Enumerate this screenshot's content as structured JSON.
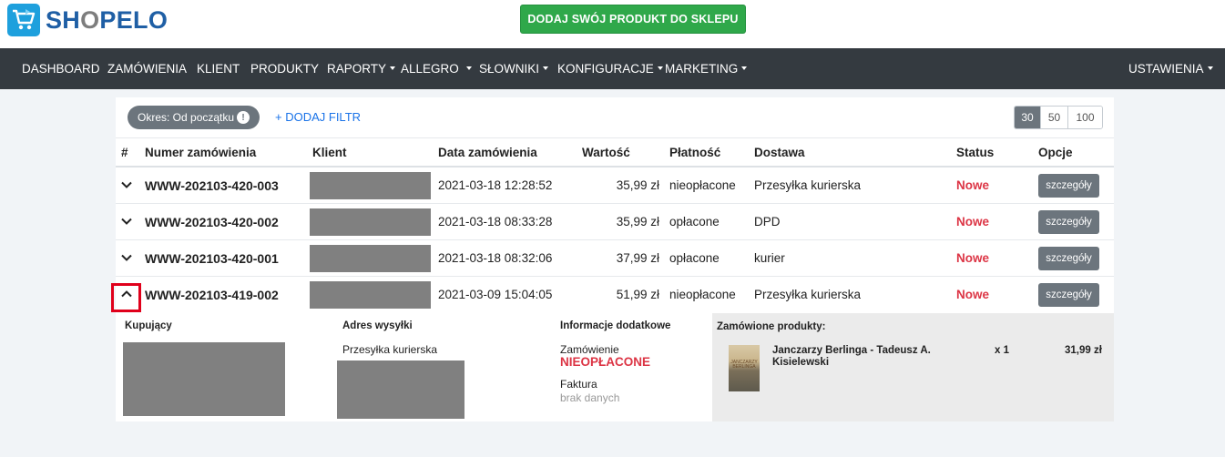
{
  "header": {
    "logo_text": "SHOPELO",
    "cta_label": "DODAJ SWÓJ PRODUKT DO SKLEPU"
  },
  "nav": {
    "items": [
      {
        "label": "DASHBOARD",
        "dropdown": false
      },
      {
        "label": "ZAMÓWIENIA",
        "dropdown": false
      },
      {
        "label": "KLIENT",
        "dropdown": false
      },
      {
        "label": "PRODUKTY",
        "dropdown": false
      },
      {
        "label": "RAPORTY",
        "dropdown": true
      },
      {
        "label": "ALLEGRO",
        "dropdown": true
      },
      {
        "label": "SŁOWNIKI",
        "dropdown": true
      },
      {
        "label": "KONFIGURACJE",
        "dropdown": true
      },
      {
        "label": "MARKETING",
        "dropdown": true
      }
    ],
    "settings_label": "USTAWIENIA"
  },
  "filters": {
    "period_label": "Okres: Od początku",
    "add_filter_label": "+ DODAJ FILTR",
    "page_sizes": [
      "30",
      "50",
      "100"
    ],
    "selected_page_size": "30"
  },
  "table": {
    "headers": {
      "hash": "#",
      "order_number": "Numer zamówienia",
      "client": "Klient",
      "date": "Data zamówienia",
      "value": "Wartość",
      "payment": "Płatność",
      "delivery": "Dostawa",
      "status": "Status",
      "options": "Opcje"
    },
    "rows": [
      {
        "order_number": "WWW-202103-420-003",
        "date": "2021-03-18 12:28:52",
        "value": "35,99 zł",
        "payment": "nieopłacone",
        "delivery": "Przesyłka kurierska",
        "status": "Nowe",
        "action": "szczegóły",
        "expanded": false
      },
      {
        "order_number": "WWW-202103-420-002",
        "date": "2021-03-18 08:33:28",
        "value": "35,99 zł",
        "payment": "opłacone",
        "delivery": "DPD",
        "status": "Nowe",
        "action": "szczegóły",
        "expanded": false
      },
      {
        "order_number": "WWW-202103-420-001",
        "date": "2021-03-18 08:32:06",
        "value": "37,99 zł",
        "payment": "opłacone",
        "delivery": "kurier",
        "status": "Nowe",
        "action": "szczegóły",
        "expanded": false
      },
      {
        "order_number": "WWW-202103-419-002",
        "date": "2021-03-09 15:04:05",
        "value": "51,99 zł",
        "payment": "nieopłacone",
        "delivery": "Przesyłka kurierska",
        "status": "Nowe",
        "action": "szczegóły",
        "expanded": true
      }
    ]
  },
  "detail": {
    "buyer_title": "Kupujący",
    "shipping_title": "Adres wysyłki",
    "shipping_method": "Przesyłka kurierska",
    "info_title": "Informacje dodatkowe",
    "order_label": "Zamówienie",
    "order_status": "NIEOPŁACONE",
    "invoice_label": "Faktura",
    "invoice_value": "brak danych",
    "products_title": "Zamówione produkty:",
    "products": [
      {
        "name": "Janczarzy Berlinga - Tadeusz A. Kisielewski",
        "qty": "x 1",
        "price": "31,99 zł",
        "cover_text": "JANCZARZY BERLINGA"
      }
    ]
  },
  "colors": {
    "nav_bg": "#343a40",
    "cta_green": "#2fa84a",
    "status_red": "#dc3545",
    "link_blue": "#1a73e8",
    "button_grey": "#6c757d",
    "highlight_box": "#e0001b"
  }
}
